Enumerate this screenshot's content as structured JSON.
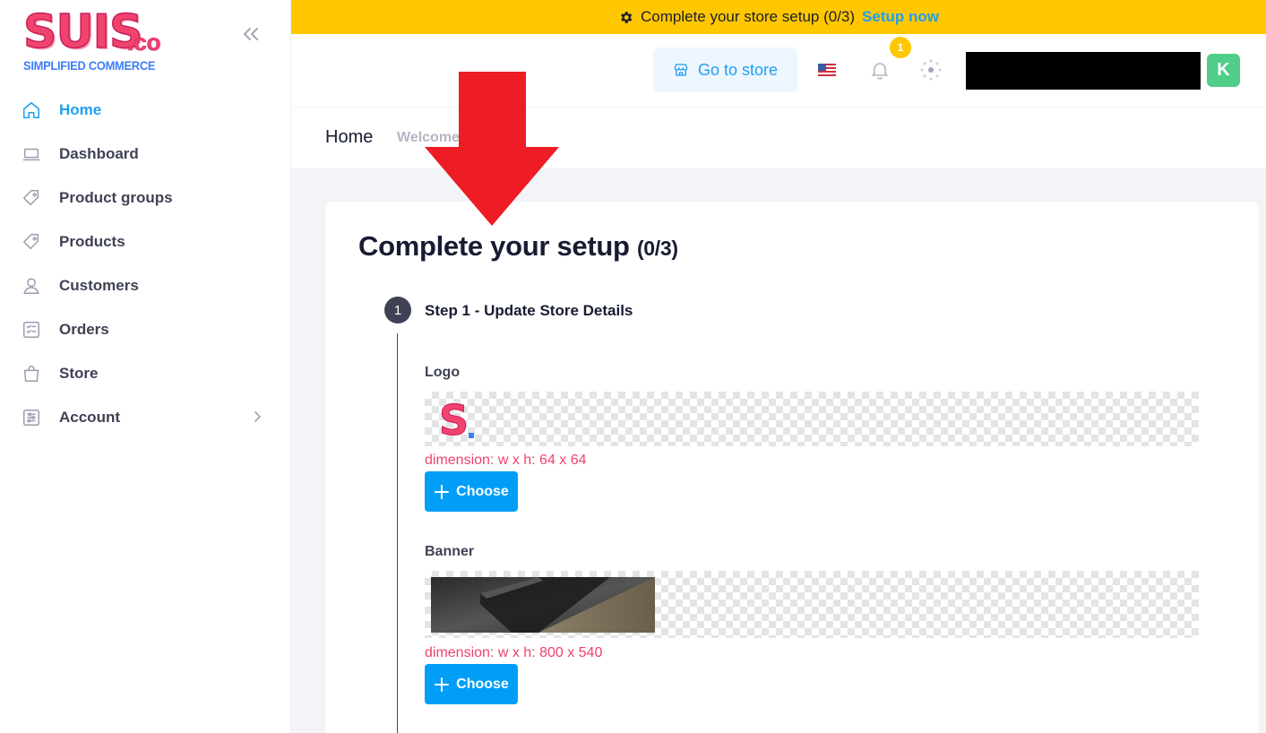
{
  "brand": {
    "logo_main": "SUIS",
    "logo_suffix": ".co",
    "tagline": "SIMPLIFIED COMMERCE",
    "primary_color": "#f0436e",
    "accent_color": "#1e9ff2"
  },
  "sidebar": {
    "collapse_icon": "double-chevron-left-icon",
    "items": [
      {
        "label": "Home",
        "icon": "home-icon",
        "active": true
      },
      {
        "label": "Dashboard",
        "icon": "laptop-icon",
        "active": false
      },
      {
        "label": "Product groups",
        "icon": "tag-icon",
        "active": false
      },
      {
        "label": "Products",
        "icon": "tag-icon",
        "active": false
      },
      {
        "label": "Customers",
        "icon": "user-icon",
        "active": false
      },
      {
        "label": "Orders",
        "icon": "checklist-icon",
        "active": false
      },
      {
        "label": "Store",
        "icon": "shopping-bag-icon",
        "active": false
      },
      {
        "label": "Account",
        "icon": "sliders-icon",
        "active": false,
        "has_submenu": true
      }
    ]
  },
  "top_banner": {
    "message": "Complete your store setup (0/3)",
    "link": "Setup now",
    "background": "#ffc700"
  },
  "header": {
    "go_to_store": "Go to store",
    "language_flag": "us-flag-icon",
    "notifications_count": "1",
    "avatar_initial": "K"
  },
  "toolbar": {
    "title": "Home",
    "subtitle": "Welcome"
  },
  "setup": {
    "title": "Complete your setup",
    "count": "(0/3)",
    "step1": {
      "number": "1",
      "title": "Step 1 - Update Store Details",
      "logo": {
        "label": "Logo",
        "dimension": "dimension: w x h: 64 x 64",
        "button": "Choose"
      },
      "banner": {
        "label": "Banner",
        "dimension": "dimension: w x h: 800 x 540",
        "button": "Choose"
      }
    }
  }
}
